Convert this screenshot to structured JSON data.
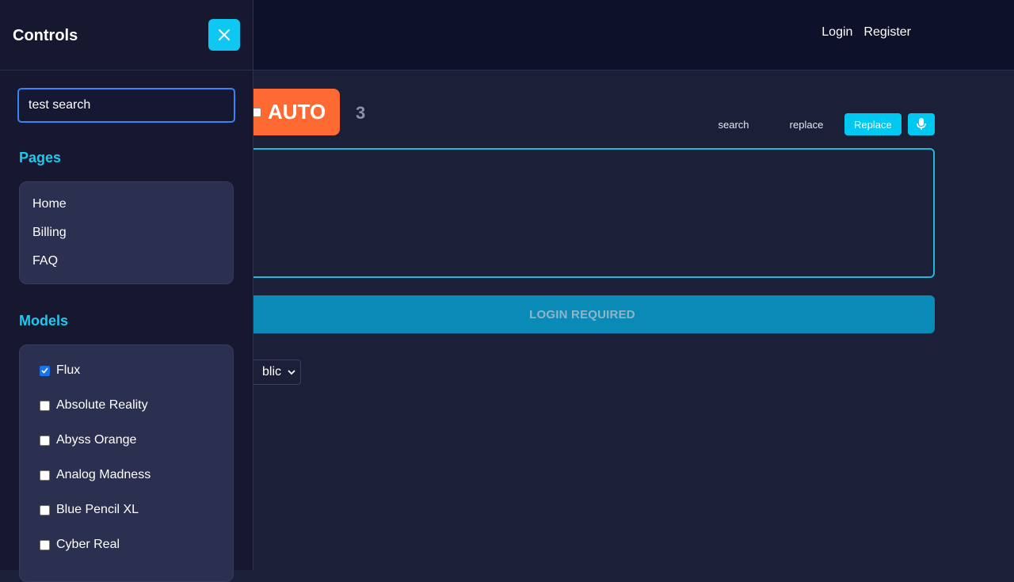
{
  "header": {
    "nav": [
      "Login",
      "Register"
    ]
  },
  "main": {
    "auto_label": "AUTO",
    "counter": "3",
    "search_label": "search",
    "replace_label": "replace",
    "replace_button": "Replace",
    "login_required": "LOGIN REQUIRED",
    "visibility_value": "blic"
  },
  "sidebar": {
    "title": "Controls",
    "search_value": "test search",
    "pages_heading": "Pages",
    "pages": [
      "Home",
      "Billing",
      "FAQ"
    ],
    "models_heading": "Models",
    "models": [
      {
        "label": "Flux",
        "checked": true
      },
      {
        "label": "Absolute Reality",
        "checked": false
      },
      {
        "label": "Abyss Orange",
        "checked": false
      },
      {
        "label": "Analog Madness",
        "checked": false
      },
      {
        "label": "Blue Pencil XL",
        "checked": false
      },
      {
        "label": "Cyber Real",
        "checked": false
      }
    ]
  },
  "colors": {
    "accent": "#00c8f0",
    "auto": "#ff6a33",
    "login_bar": "#0a8ab6",
    "bg": "#1c1f38",
    "sidebar_bg": "#15182f"
  }
}
